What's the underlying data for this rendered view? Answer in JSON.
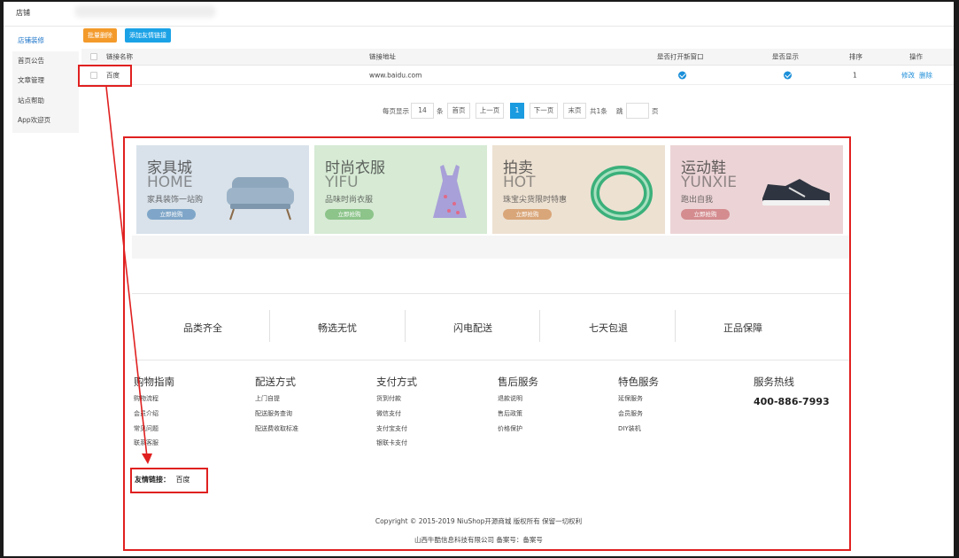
{
  "header": {
    "tab_title": "店铺"
  },
  "sidebar": {
    "items": [
      {
        "label": "店铺装修",
        "active": true
      },
      {
        "label": "首页公告",
        "active": false
      },
      {
        "label": "文章管理",
        "active": false
      },
      {
        "label": "站点帮助",
        "active": false
      },
      {
        "label": "App欢迎页",
        "active": false
      }
    ]
  },
  "toolbar": {
    "batch_delete": "批量删除",
    "add_link": "添加友情链接"
  },
  "table": {
    "headers": {
      "name": "链接名称",
      "url": "链接地址",
      "new_window": "是否打开新窗口",
      "display": "是否显示",
      "sort": "排序",
      "action": "操作"
    },
    "rows": [
      {
        "name": "百度",
        "url": "www.baidu.com",
        "new_window": true,
        "display": true,
        "sort": "1",
        "edit": "修改",
        "delete": "删除"
      }
    ]
  },
  "pager": {
    "per_page_label": "每页显示",
    "per_page": "14",
    "unit": "条",
    "first": "首页",
    "prev": "上一页",
    "current": "1",
    "next": "下一页",
    "last": "末页",
    "total": "共1条",
    "jump": "跳",
    "page_unit": "页"
  },
  "promos": [
    {
      "title": "家具城",
      "en": "HOME",
      "sub": "家具装饰一站购",
      "btn": "立即抢购",
      "bg": "#d9e2ea",
      "btn_color": "#7fa6c8",
      "icon": "sofa-icon"
    },
    {
      "title": "时尚衣服",
      "en": "YIFU",
      "sub": "品味时尚衣服",
      "btn": "立即抢购",
      "bg": "#d6ead4",
      "btn_color": "#8cc48a",
      "icon": "dress-icon"
    },
    {
      "title": "拍卖",
      "en": "HOT",
      "sub": "珠宝尖货限时特惠",
      "btn": "立即抢购",
      "bg": "#ede1d2",
      "btn_color": "#d9a679",
      "icon": "bracelet-icon"
    },
    {
      "title": "运动鞋",
      "en": "YUNXIE",
      "sub": "跑出自我",
      "btn": "立即抢购",
      "bg": "#ecd4d6",
      "btn_color": "#d48c8f",
      "icon": "sneaker-icon"
    }
  ],
  "features": [
    "品类齐全",
    "畅选无忧",
    "闪电配送",
    "七天包退",
    "正品保障"
  ],
  "footer_columns": [
    {
      "title": "购物指南",
      "items": [
        "购物流程",
        "会员介绍",
        "常见问题",
        "联系客服"
      ]
    },
    {
      "title": "配送方式",
      "items": [
        "上门自提",
        "配送服务查询",
        "配送费收取标准"
      ]
    },
    {
      "title": "支付方式",
      "items": [
        "货到付款",
        "微信支付",
        "支付宝支付",
        "银联卡支付"
      ]
    },
    {
      "title": "售后服务",
      "items": [
        "退款说明",
        "售后政策",
        "价格保护"
      ]
    },
    {
      "title": "特色服务",
      "items": [
        "延保服务",
        "会员服务",
        "DIY装机"
      ]
    }
  ],
  "hotline": {
    "title": "服务热线",
    "number": "400-886-7993"
  },
  "friend_links": {
    "label": "友情链接：",
    "value": "百度"
  },
  "copyright": "Copyright © 2015-2019 NiuShop开源商城 版权所有 保留一切权利",
  "company": "山西牛酷信息科技有限公司 备案号：备案号",
  "colors": {
    "annotation_red": "#e02020",
    "primary_blue": "#1ba2e6",
    "orange": "#f39a2b"
  }
}
